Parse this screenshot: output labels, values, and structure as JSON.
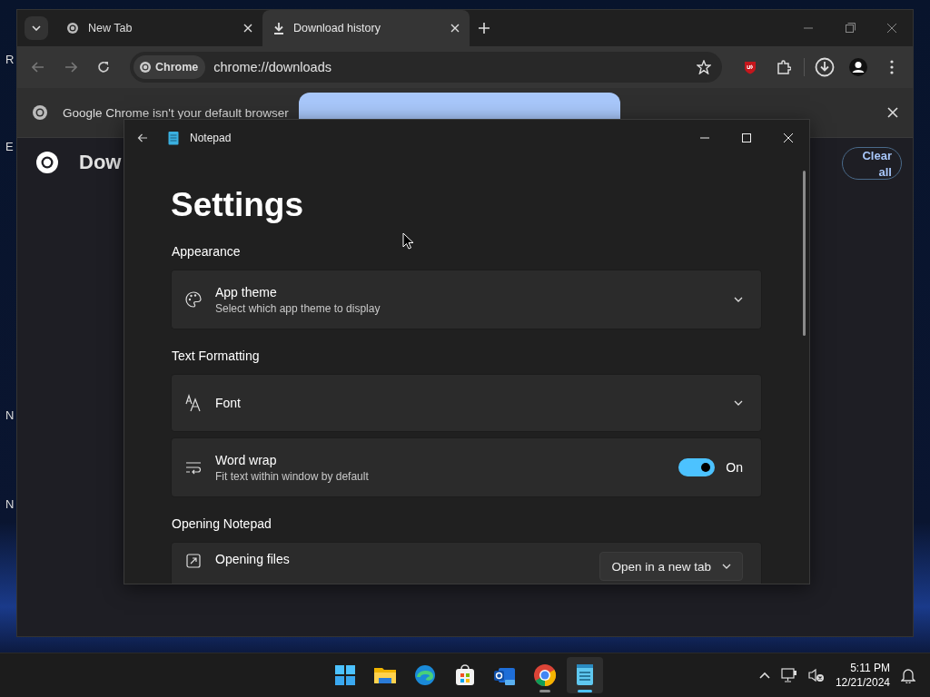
{
  "desktop_icons": [
    {
      "label": "R"
    },
    {
      "label": "E"
    },
    {
      "label": "N"
    },
    {
      "label": "N"
    }
  ],
  "browser": {
    "tabs": [
      {
        "title": "New Tab",
        "selected": false
      },
      {
        "title": "Download history",
        "selected": true
      }
    ],
    "address": {
      "chip": "Chrome",
      "url": "chrome://downloads"
    },
    "infobar": {
      "message": "Google Chrome isn't your default browser"
    },
    "page": {
      "heading": "Dow",
      "clear_button": "Clear all"
    }
  },
  "notepad": {
    "title": "Notepad",
    "heading": "Settings",
    "sections": [
      {
        "title": "Appearance",
        "items": [
          {
            "kind": "dropdown",
            "label": "App theme",
            "description": "Select which app theme to display"
          }
        ]
      },
      {
        "title": "Text Formatting",
        "items": [
          {
            "kind": "dropdown",
            "label": "Font"
          },
          {
            "kind": "toggle",
            "label": "Word wrap",
            "description": "Fit text within window by default",
            "on": true,
            "state_text": "On"
          }
        ]
      },
      {
        "title": "Opening Notepad",
        "items": [
          {
            "kind": "select",
            "label": "Opening files",
            "value": "Open in a new tab"
          }
        ]
      }
    ]
  },
  "taskbar": {
    "apps": [
      {
        "kind": "start",
        "running": false,
        "selected": false
      },
      {
        "kind": "explorer",
        "running": false,
        "selected": false
      },
      {
        "kind": "edge",
        "running": false,
        "selected": false
      },
      {
        "kind": "store",
        "running": false,
        "selected": false
      },
      {
        "kind": "outlook",
        "running": false,
        "selected": false
      },
      {
        "kind": "chrome",
        "running": true,
        "selected": false
      },
      {
        "kind": "notepad",
        "running": true,
        "selected": true
      }
    ],
    "time": "5:11 PM",
    "date": "12/21/2024"
  }
}
